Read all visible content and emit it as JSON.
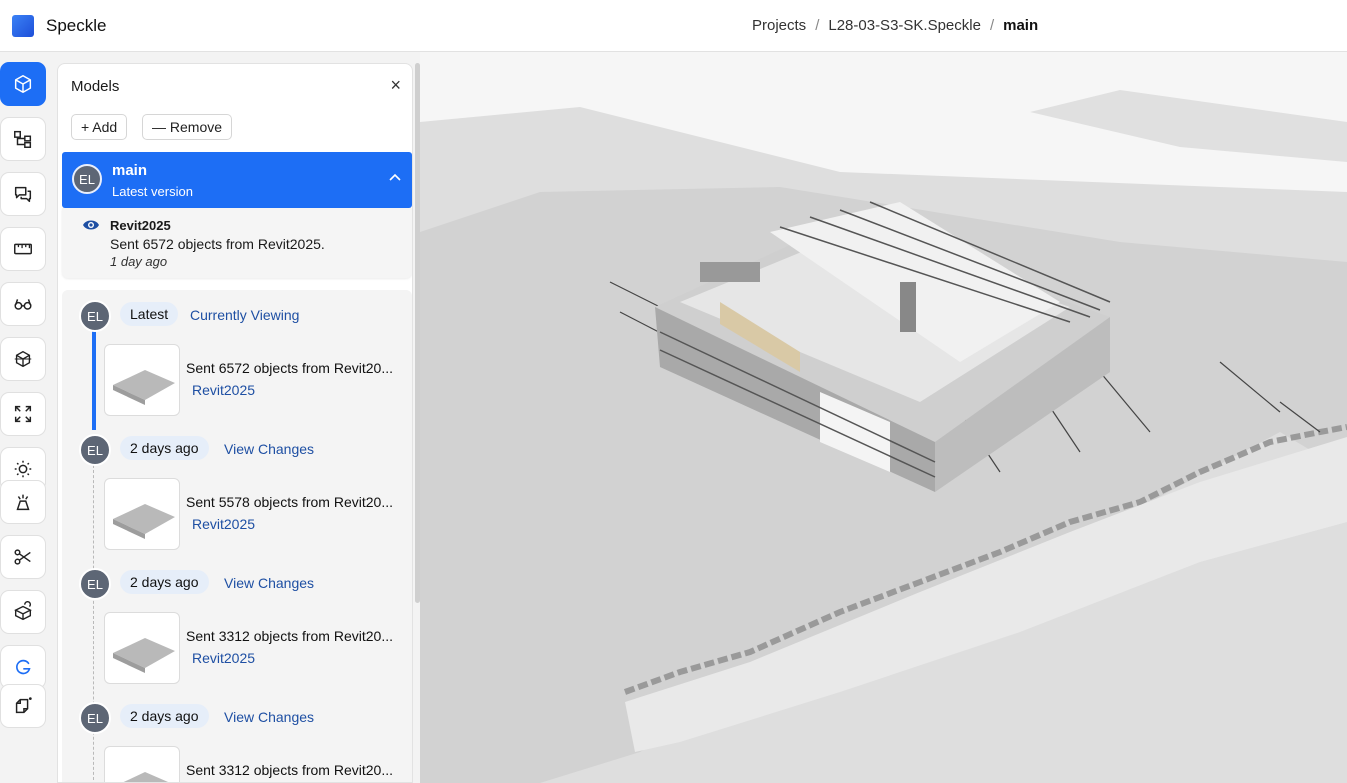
{
  "app": {
    "brand": "Speckle"
  },
  "breadcrumb": {
    "items": [
      "Projects",
      "L28-03-S3-SK.Speckle",
      "main"
    ]
  },
  "toolbar": {
    "tools": [
      "models-icon",
      "scene-explorer-icon",
      "discussions-icon",
      "measure-icon",
      "views-icon",
      "section-box-icon",
      "zoom-extents-icon",
      "light-icon",
      "explode-icon",
      "filter-cut-icon",
      "isolate-icon",
      "gendo-icon",
      "new-view-icon"
    ]
  },
  "panel": {
    "title": "Models",
    "add_label": "+ Add",
    "remove_label": "— Remove",
    "model": {
      "avatar": "EL",
      "name": "main",
      "subtitle": "Latest version",
      "source": "Revit2025",
      "message": "Sent 6572 objects from Revit2025.",
      "time": "1 day ago"
    },
    "versions": [
      {
        "avatar": "EL",
        "pill": "Latest",
        "link": "Currently Viewing",
        "message": "Sent 6572 objects from Revit20...",
        "source": "Revit2025"
      },
      {
        "avatar": "EL",
        "pill": "2 days ago",
        "link": "View Changes",
        "message": "Sent 5578 objects from Revit20...",
        "source": "Revit2025"
      },
      {
        "avatar": "EL",
        "pill": "2 days ago",
        "link": "View Changes",
        "message": "Sent 3312 objects from Revit20...",
        "source": "Revit2025"
      },
      {
        "avatar": "EL",
        "pill": "2 days ago",
        "link": "View Changes",
        "message": "Sent 3312 objects from Revit20...",
        "source": ""
      }
    ]
  },
  "colors": {
    "accent": "#1d6ef5",
    "link": "#1e4fa3"
  }
}
